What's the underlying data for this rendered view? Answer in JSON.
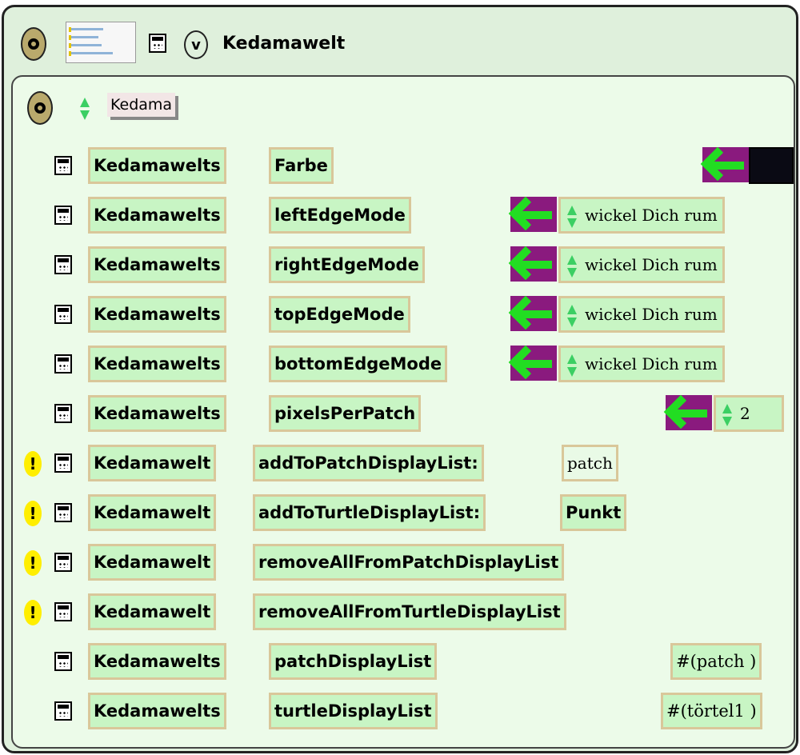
{
  "viewer": {
    "title": "Kedamawelt",
    "menu_button": "v"
  },
  "object": {
    "name": "Kedama"
  },
  "rows": [
    {
      "owner": "Kedamawelts",
      "slot": "Farbe",
      "value": "",
      "kind": "color",
      "swatch_color": "#0a0a14"
    },
    {
      "owner": "Kedamawelts",
      "slot": "leftEdgeMode",
      "value": "wickel Dich rum",
      "kind": "setter"
    },
    {
      "owner": "Kedamawelts",
      "slot": "rightEdgeMode",
      "value": "wickel Dich rum",
      "kind": "setter"
    },
    {
      "owner": "Kedamawelts",
      "slot": "topEdgeMode",
      "value": "wickel Dich rum",
      "kind": "setter"
    },
    {
      "owner": "Kedamawelts",
      "slot": "bottomEdgeMode",
      "value": "wickel Dich rum",
      "kind": "setter"
    },
    {
      "owner": "Kedamawelts",
      "slot": "pixelsPerPatch",
      "value": "2",
      "kind": "setter"
    },
    {
      "owner": "Kedamawelt",
      "slot": "addToPatchDisplayList:",
      "arg": "patch",
      "kind": "command"
    },
    {
      "owner": "Kedamawelt",
      "slot": "addToTurtleDisplayList:",
      "arg": "Punkt",
      "kind": "command"
    },
    {
      "owner": "Kedamawelt",
      "slot": "removeAllFromPatchDisplayList",
      "kind": "command"
    },
    {
      "owner": "Kedamawelt",
      "slot": "removeAllFromTurtleDisplayList",
      "kind": "command"
    },
    {
      "owner": "Kedamawelts",
      "slot": "patchDisplayList",
      "value": "#(patch )",
      "kind": "readout"
    },
    {
      "owner": "Kedamawelts",
      "slot": "turtleDisplayList",
      "value": "#(törtel1 )",
      "kind": "readout"
    }
  ],
  "colors": {
    "panel_bg": "#ecfbe9",
    "tile_bg": "#c8f5c4",
    "tile_border": "#d9c79a",
    "arrow_bg": "#8a1a7e",
    "arrow_fg": "#22dd22",
    "bang": "#ffee00"
  },
  "icons": [
    "halo-button-icon",
    "thumbnail-icon",
    "calculator-icon",
    "menu-button-icon",
    "up-down-arrow-icon",
    "assign-arrow-icon",
    "exclamation-icon"
  ]
}
